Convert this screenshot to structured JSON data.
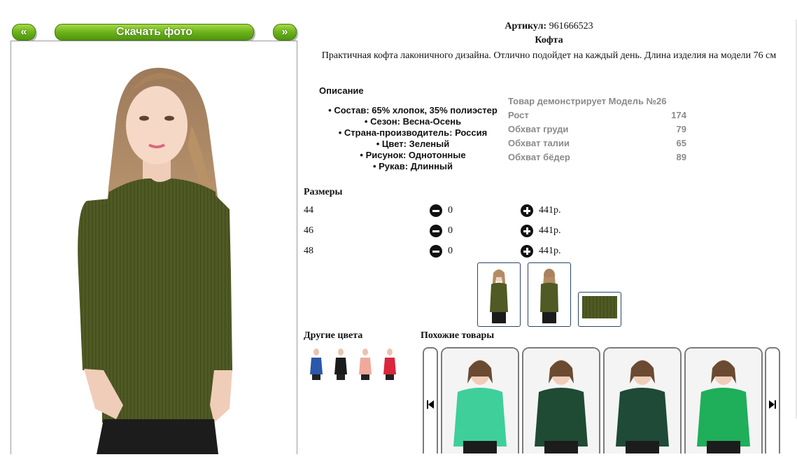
{
  "nav": {
    "prev_label": "«",
    "download_label": "Скачать фото",
    "next_label": "»"
  },
  "product": {
    "article_label": "Артикул:",
    "article_value": "961666523",
    "name": "Кофта",
    "summary": "Практичная кофта лаконичного дизайна. Отлично подойдет на каждый день. Длина изделия на модели 76 см",
    "color": "#4f5a24"
  },
  "description": {
    "title": "Описание",
    "items": [
      "Состав: 65% хлопок, 35% полиэстер",
      "Сезон: Весна-Осень",
      "Страна-производитель: Россия",
      "Цвет: Зеленый",
      "Рисунок: Однотонные",
      "Рукав: Длинный"
    ]
  },
  "model": {
    "title": "Товар демонстрирует Модель №26",
    "rows": [
      {
        "label": "Рост",
        "value": "174"
      },
      {
        "label": "Обхват груди",
        "value": "79"
      },
      {
        "label": "Обхват талии",
        "value": "65"
      },
      {
        "label": "Обхват бёдер",
        "value": "89"
      }
    ]
  },
  "sizes": {
    "title": "Размеры",
    "rows": [
      {
        "size": "44",
        "qty": "0",
        "price": "441р."
      },
      {
        "size": "46",
        "qty": "0",
        "price": "441р."
      },
      {
        "size": "48",
        "qty": "0",
        "price": "441р."
      }
    ]
  },
  "other_colors": {
    "title": "Другие цвета",
    "swatches": [
      "#2b58a8",
      "#1b1b1b",
      "#f0a99a",
      "#d9263c"
    ]
  },
  "similar": {
    "title": "Похожие товары",
    "items": [
      {
        "color": "#3fcf9a"
      },
      {
        "color": "#1f4a34"
      },
      {
        "color": "#1f4a38"
      },
      {
        "color": "#1fae5a"
      }
    ]
  },
  "icons": {
    "minus": "minus-circle-icon",
    "plus": "plus-circle-icon",
    "prev": "skip-prev-icon",
    "next": "skip-next-icon"
  }
}
